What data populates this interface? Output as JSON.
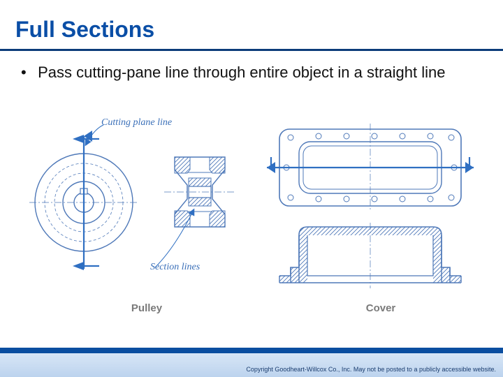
{
  "title": "Full Sections",
  "bullet": "Pass cutting-pane line through entire object in a straight line",
  "callouts": {
    "cutting_plane_line": "Cutting plane line",
    "section_lines": "Section lines"
  },
  "figure_labels": {
    "pulley": "Pulley",
    "cover": "Cover"
  },
  "footer": "Copyright Goodheart-Willcox Co., Inc.  May not be posted to a publicly accessible website."
}
